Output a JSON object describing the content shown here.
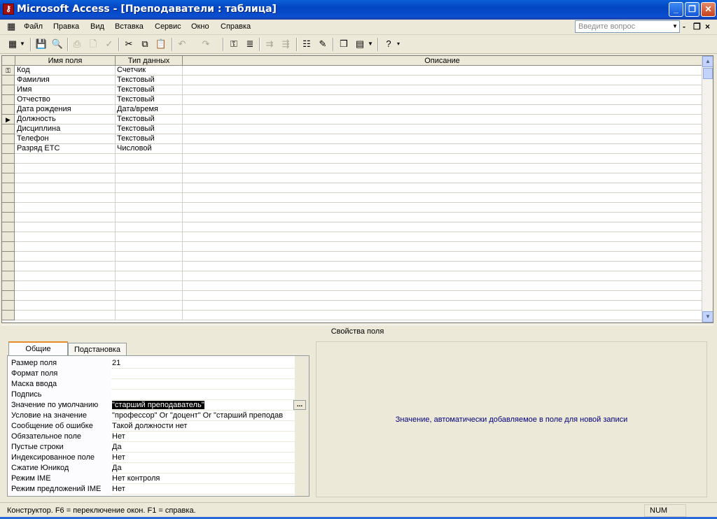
{
  "window": {
    "title": "Microsoft Access - [Преподаватели : таблица]",
    "icon": "access-key-icon"
  },
  "menu": {
    "items": [
      {
        "label": "Файл",
        "key": "Ф"
      },
      {
        "label": "Правка",
        "key": "П"
      },
      {
        "label": "Вид",
        "key": "В"
      },
      {
        "label": "Вставка",
        "key": "с"
      },
      {
        "label": "Сервис",
        "key": "С"
      },
      {
        "label": "Окно",
        "key": "О"
      },
      {
        "label": "Справка",
        "key": "С"
      }
    ],
    "help_placeholder": "Введите вопрос"
  },
  "grid": {
    "columns": [
      "Имя поля",
      "Тип данных",
      "Описание"
    ],
    "rows": [
      {
        "name": "Код",
        "type": "Счетчик",
        "marker": "key"
      },
      {
        "name": "Фамилия",
        "type": "Текстовый",
        "marker": ""
      },
      {
        "name": "Имя",
        "type": "Текстовый",
        "marker": ""
      },
      {
        "name": "Отчество",
        "type": "Текстовый",
        "marker": ""
      },
      {
        "name": "Дата рождения",
        "type": "Дата/время",
        "marker": ""
      },
      {
        "name": "Должность",
        "type": "Текстовый",
        "marker": "current"
      },
      {
        "name": "Дисциплина",
        "type": "Текстовый",
        "marker": ""
      },
      {
        "name": "Телефон",
        "type": "Текстовый",
        "marker": ""
      },
      {
        "name": "Разряд  ЕТС",
        "type": "Числовой",
        "marker": ""
      }
    ]
  },
  "field_properties": {
    "title": "Свойства поля",
    "tabs": [
      "Общие",
      "Подстановка"
    ],
    "active_tab": "Общие",
    "rows": [
      {
        "label": "Размер поля",
        "value": "21"
      },
      {
        "label": "Формат поля",
        "value": ""
      },
      {
        "label": "Маска ввода",
        "value": ""
      },
      {
        "label": "Подпись",
        "value": ""
      },
      {
        "label": "Значение по умолчанию",
        "value": "\"старший преподаватель\""
      },
      {
        "label": "Условие на значение",
        "value": "\"профессор\" Or \"доцент\" Or \"старший преподав"
      },
      {
        "label": "Сообщение об ошибке",
        "value": "Такой должности нет"
      },
      {
        "label": "Обязательное поле",
        "value": "Нет"
      },
      {
        "label": "Пустые строки",
        "value": "Да"
      },
      {
        "label": "Индексированное поле",
        "value": "Нет"
      },
      {
        "label": "Сжатие Юникод",
        "value": "Да"
      },
      {
        "label": "Режим IME",
        "value": "Нет контроля"
      },
      {
        "label": "Режим предложений IME",
        "value": "Нет"
      }
    ],
    "builder_button": "...",
    "hint": "Значение, автоматически добавляемое в поле для новой записи"
  },
  "status": {
    "message": "Конструктор.  F6 = переключение окон.  F1 = справка.",
    "num": "NUM"
  },
  "colors": {
    "titlebar": "#0a5fd8",
    "hint_text": "#00007f",
    "selection": "#000000"
  }
}
